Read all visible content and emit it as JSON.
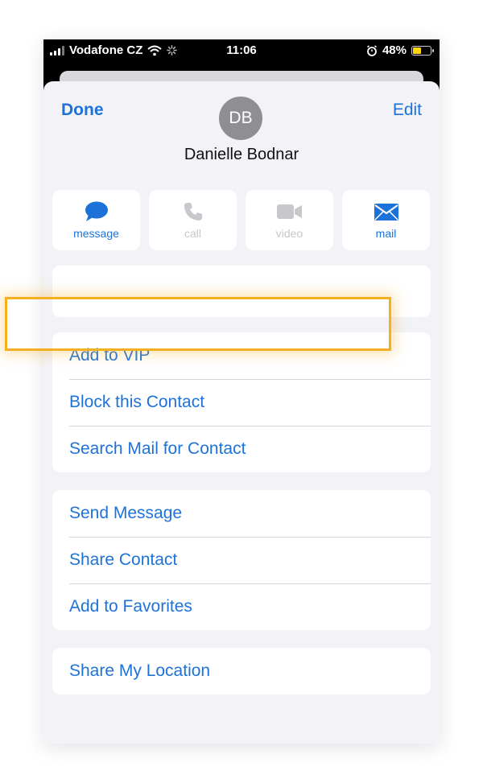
{
  "status_bar": {
    "carrier": "Vodafone CZ",
    "time": "11:06",
    "battery": "48%",
    "battery_level": 0.48,
    "battery_color": "#ffd60a"
  },
  "header": {
    "done_label": "Done",
    "edit_label": "Edit",
    "avatar_initials": "DB",
    "contact_name": "Danielle Bodnar"
  },
  "actions": [
    {
      "label": "message",
      "icon": "message-bubble-icon",
      "enabled": true
    },
    {
      "label": "call",
      "icon": "phone-icon",
      "enabled": false
    },
    {
      "label": "video",
      "icon": "video-camera-icon",
      "enabled": false
    },
    {
      "label": "mail",
      "icon": "envelope-icon",
      "enabled": true
    }
  ],
  "groups": {
    "mail_options": [
      "Add to VIP",
      "Block this Contact",
      "Search Mail for Contact"
    ],
    "contact_options": [
      "Send Message",
      "Share Contact",
      "Add to Favorites"
    ],
    "location_options": [
      "Share My Location"
    ]
  },
  "highlight": {
    "target": "Block this Contact",
    "color": "#f5b021"
  },
  "colors": {
    "accent": "#1d72d9",
    "disabled": "#c7c7cc",
    "background": "#f2f2f7"
  }
}
